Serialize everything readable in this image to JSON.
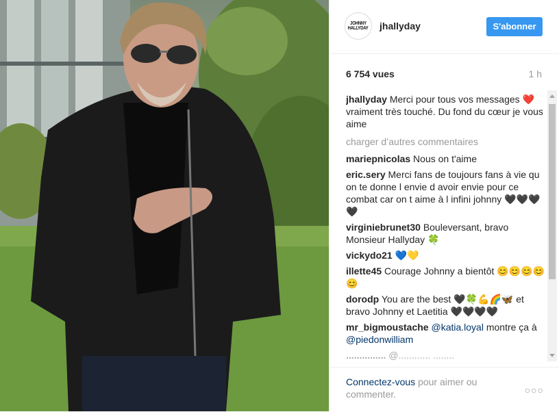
{
  "header": {
    "avatar_line1": "JOHNNY",
    "avatar_line2": "HALLYDAY",
    "username": "jhallyday",
    "follow_label": "S'abonner"
  },
  "meta": {
    "views": "6 754 vues",
    "time": "1 h"
  },
  "caption": {
    "user": "jhallyday",
    "text_before": "Merci pour tous vos messages",
    "emoji": "❤️",
    "text_after": "vraiment très touché. Du fond du cœur je vous aime"
  },
  "load_more": "charger d’autres commentaires",
  "comments": [
    {
      "user": "mariepnicolas",
      "text": "Nous on t'aime"
    },
    {
      "user": "eric.sery",
      "text": "Merci fans de toujours fans à vie qu on te donne l envie d avoir envie pour ce combat car on t aime à l infini johnny 🖤🖤🖤🖤"
    },
    {
      "user": "virginiebrunet30",
      "text": "Bouleversant, bravo Monsieur Hallyday 🍀"
    },
    {
      "user": "vickydo21",
      "text": "💙💛"
    },
    {
      "user": "illette45",
      "text": "Courage Johnny a bientôt 😊😊😊😊😊"
    },
    {
      "user": "dorodp",
      "text": "You are the best 🖤🍀💪🌈🦋 et bravo Johnny et Laetitia 🖤🖤🖤🖤"
    }
  ],
  "mention_comment": {
    "user": "mr_bigmoustache",
    "mention1": "@katia.loyal",
    "middle": "montre ça à",
    "mention2": "@piedonwilliam"
  },
  "partial_comment": {
    "user": "...............",
    "text": "@............ ........"
  },
  "footer": {
    "login_link": "Connectez-vous",
    "login_text": "pour aimer ou commenter.",
    "more_icon": "more-options-icon"
  }
}
